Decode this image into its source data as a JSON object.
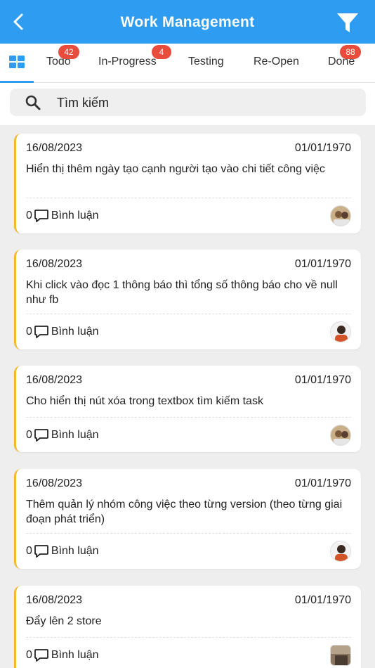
{
  "header": {
    "title": "Work Management"
  },
  "tabs": [
    {
      "label": "Todo",
      "badge": "42"
    },
    {
      "label": "In-Progress",
      "badge": "4"
    },
    {
      "label": "Testing"
    },
    {
      "label": "Re-Open"
    },
    {
      "label": "Done",
      "badge": "88"
    }
  ],
  "search": {
    "placeholder": "Tìm kiếm"
  },
  "colors": {
    "accent": "#2e9cf0",
    "card_border": "#f5b82e",
    "badge": "#e74c3c"
  },
  "tasks": [
    {
      "start_date": "16/08/2023",
      "end_date": "01/01/1970",
      "title": "Hiển thị thêm ngày tạo cạnh người tạo vào chi tiết công việc",
      "comment_count": "0",
      "comment_label": "Bình luận"
    },
    {
      "start_date": "16/08/2023",
      "end_date": "01/01/1970",
      "title": "Khi click vào đọc 1 thông báo thì tổng số thông báo cho về null như fb",
      "comment_count": "0",
      "comment_label": "Bình luận"
    },
    {
      "start_date": "16/08/2023",
      "end_date": "01/01/1970",
      "title": "Cho hiển thị nút xóa trong textbox tìm kiếm task",
      "comment_count": "0",
      "comment_label": "Bình luận"
    },
    {
      "start_date": "16/08/2023",
      "end_date": "01/01/1970",
      "title": "Thêm quản lý nhóm công việc theo từng version (theo từng giai đoạn phát triển)",
      "comment_count": "0",
      "comment_label": "Bình luận"
    },
    {
      "start_date": "16/08/2023",
      "end_date": "01/01/1970",
      "title": "Đẩy lên 2 store",
      "comment_count": "0",
      "comment_label": "Bình luận"
    }
  ]
}
